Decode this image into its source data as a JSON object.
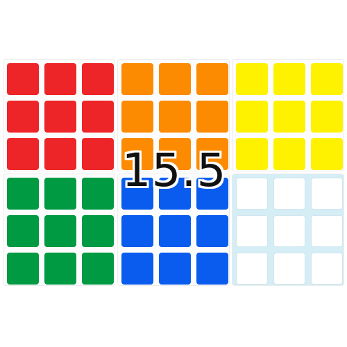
{
  "label": "15.5",
  "sheets": [
    {
      "name": "red-sticker-sheet",
      "color": "#ee2528"
    },
    {
      "name": "orange-sticker-sheet",
      "color": "#fc8b02"
    },
    {
      "name": "yellow-sticker-sheet",
      "color": "#fef200"
    },
    {
      "name": "green-sticker-sheet",
      "color": "#009a43"
    },
    {
      "name": "blue-sticker-sheet",
      "color": "#0a5cee"
    },
    {
      "name": "white-sticker-sheet",
      "color": "#ffffff",
      "border": "#cfe6ef",
      "backing": "#d5edf5"
    }
  ]
}
